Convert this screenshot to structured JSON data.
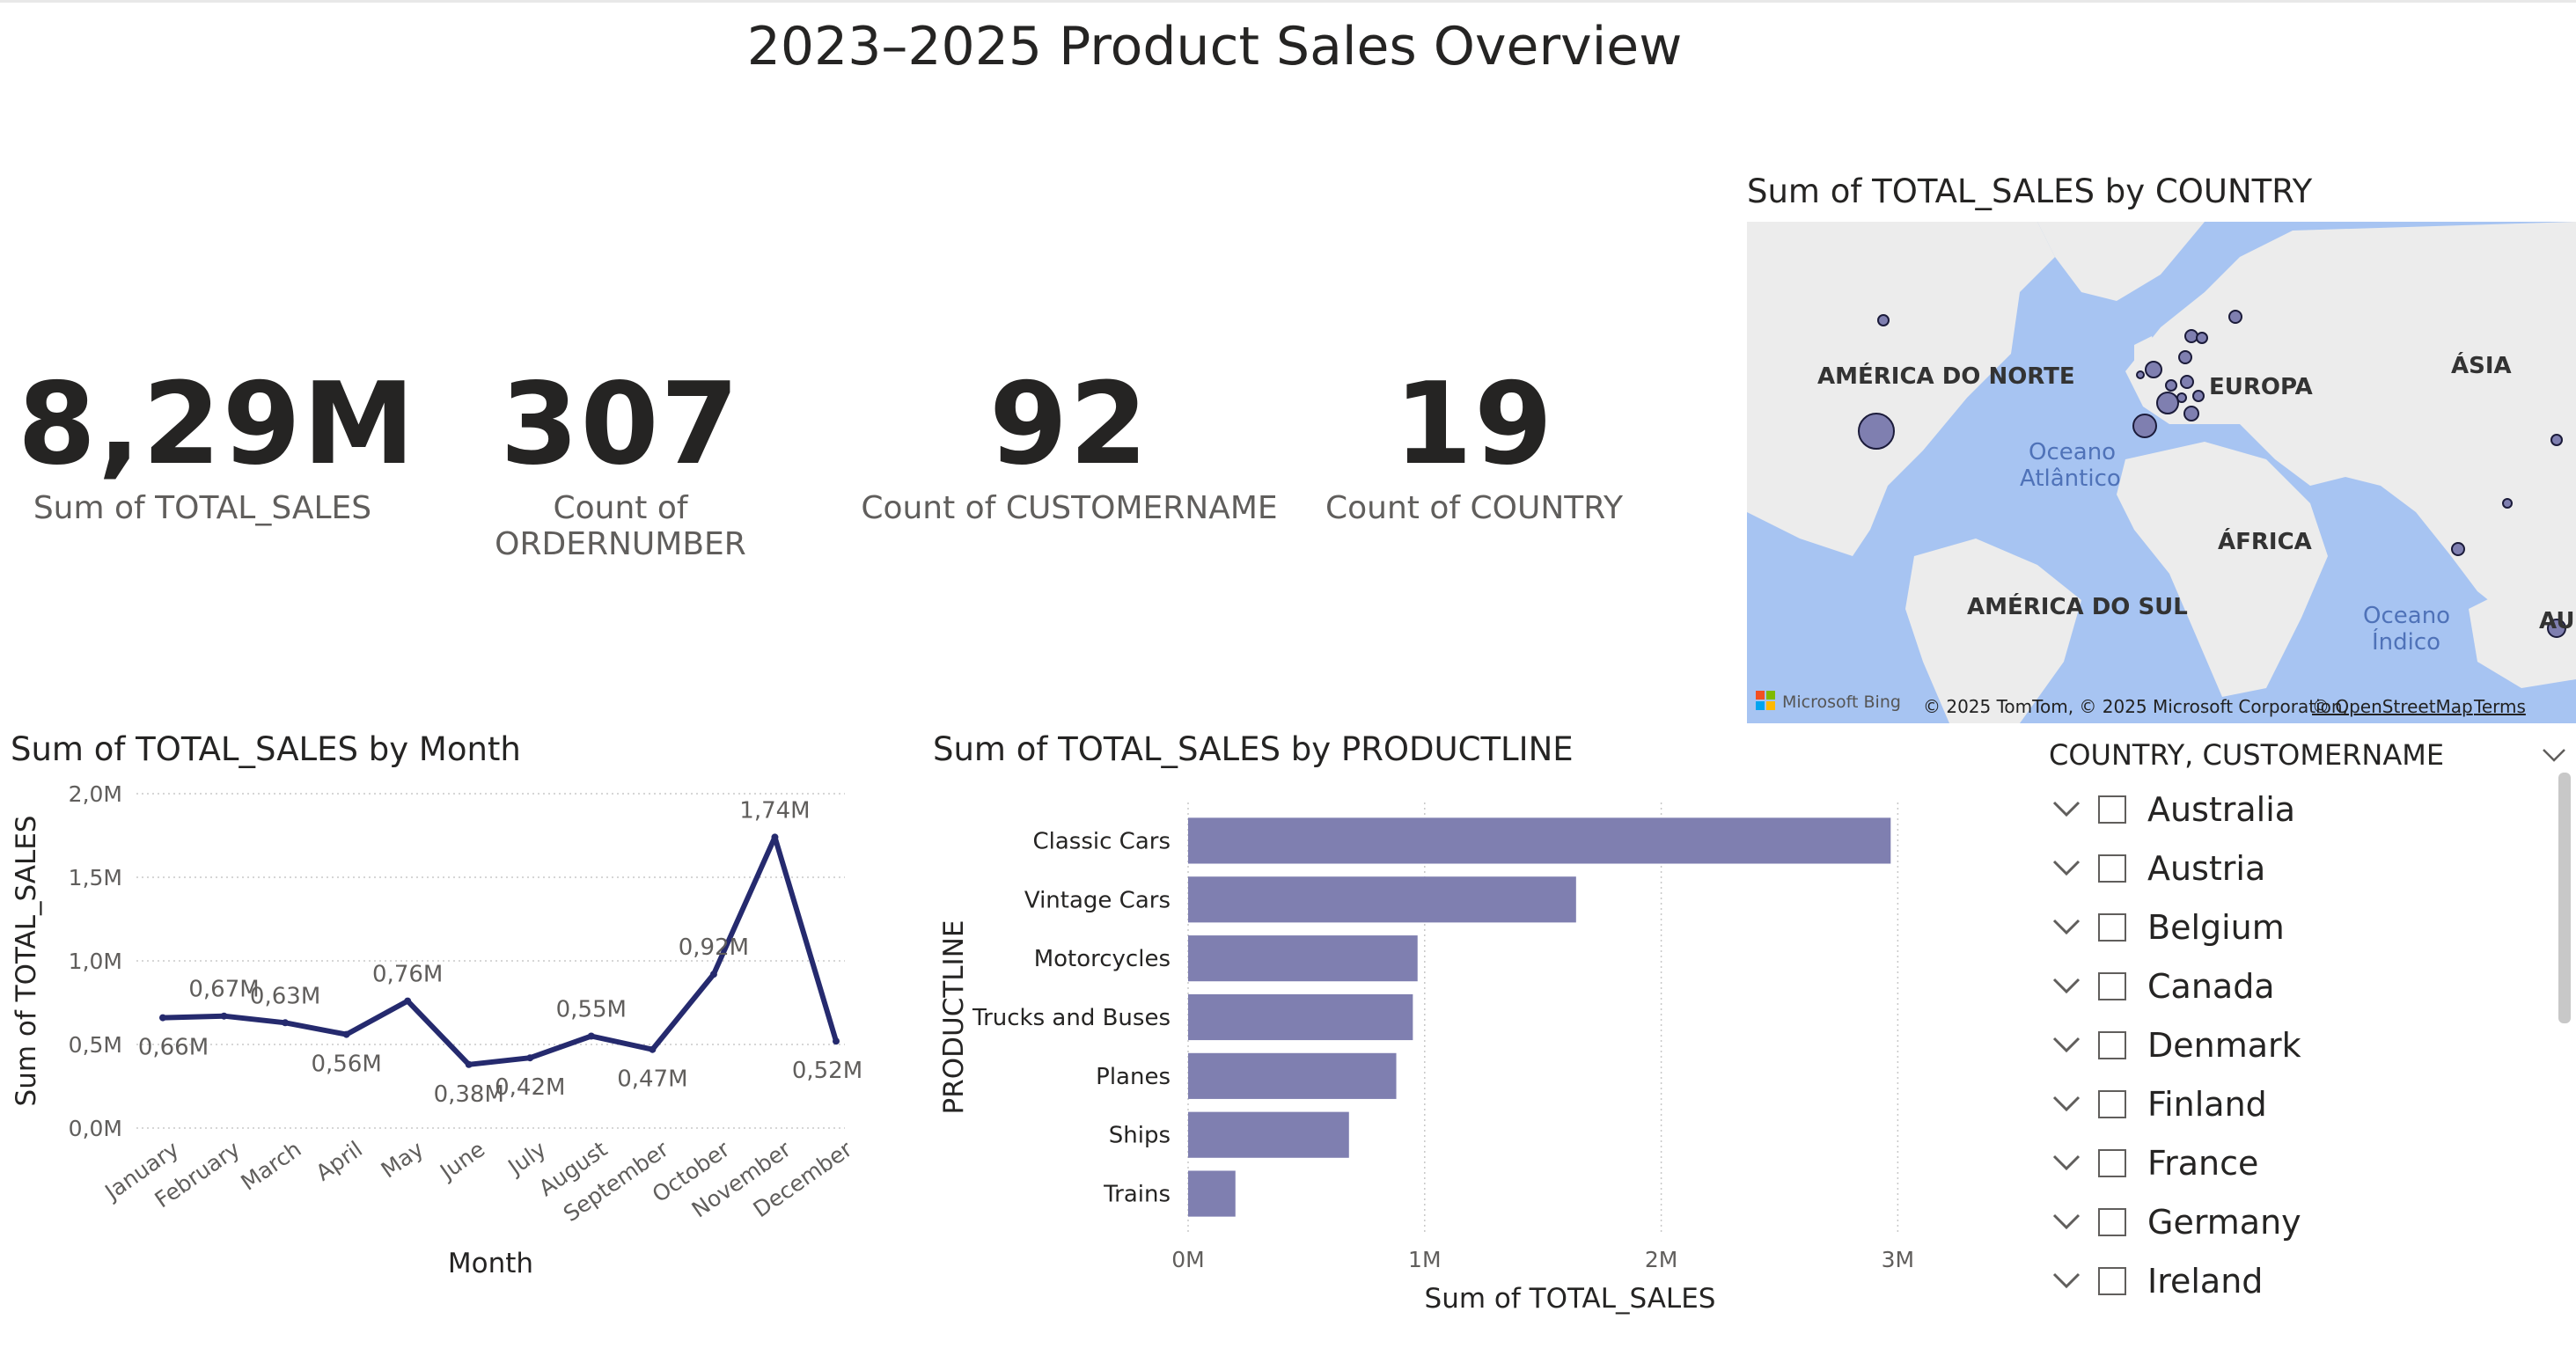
{
  "report": {
    "title": "2023–2025 Product Sales Overview"
  },
  "kpis": [
    {
      "value": "8,29M",
      "label": "Sum of TOTAL_SALES"
    },
    {
      "value": "307",
      "label": "Count of ORDERNUMBER"
    },
    {
      "value": "92",
      "label": "Count of CUSTOMERNAME"
    },
    {
      "value": "19",
      "label": "Count of COUNTRY"
    }
  ],
  "map": {
    "title": "Sum of TOTAL_SALES by COUNTRY",
    "labels": {
      "north_america": "AMÉRICA DO NORTE",
      "europe": "EUROPA",
      "asia": "ÁSIA",
      "africa": "ÁFRICA",
      "south_america": "AMÉRICA DO SUL",
      "australia": "AUS",
      "atlantic_1": "Oceano",
      "atlantic_2": "Atlântico",
      "indian_1": "Oceano",
      "indian_2": "Índico"
    },
    "brand": "Microsoft Bing",
    "copyright": "© 2025 TomTom, © 2025 Microsoft Corporation,",
    "osm_link": "© OpenStreetMap",
    "terms_link": "Terms",
    "bubble_color": "#7f7fb0"
  },
  "line_chart": {
    "title": "Sum of TOTAL_SALES by Month"
  },
  "bar_chart": {
    "title": "Sum of TOTAL_SALES by PRODUCTLINE"
  },
  "chart_data": [
    {
      "type": "line",
      "title": "Sum of TOTAL_SALES by Month",
      "xlabel": "Month",
      "ylabel": "Sum of TOTAL_SALES",
      "x": [
        "January",
        "February",
        "March",
        "April",
        "May",
        "June",
        "July",
        "August",
        "September",
        "October",
        "November",
        "December"
      ],
      "values": [
        0.66,
        0.67,
        0.63,
        0.56,
        0.76,
        0.38,
        0.42,
        0.55,
        0.47,
        0.92,
        1.74,
        0.52
      ],
      "data_labels": [
        "0,66M",
        "0,67M",
        "0,63M",
        "0,56M",
        "0,76M",
        "0,38M",
        "0,42M",
        "0,55M",
        "0,47M",
        "0,92M",
        "1,74M",
        "0,52M"
      ],
      "yticks": [
        0,
        0.5,
        1.0,
        1.5,
        2.0
      ],
      "ytick_labels": [
        "0,0M",
        "0,5M",
        "1,0M",
        "1,5M",
        "2,0M"
      ],
      "ylim": [
        0,
        2.0
      ],
      "grid": true,
      "color": "#252a6e"
    },
    {
      "type": "bar",
      "orientation": "horizontal",
      "title": "Sum of TOTAL_SALES by PRODUCTLINE",
      "xlabel": "Sum of TOTAL_SALES",
      "ylabel": "PRODUCTLINE",
      "categories": [
        "Classic Cars",
        "Vintage Cars",
        "Motorcycles",
        "Trucks and Buses",
        "Planes",
        "Ships",
        "Trains"
      ],
      "values": [
        2.97,
        1.64,
        0.97,
        0.95,
        0.88,
        0.68,
        0.2
      ],
      "xticks": [
        0,
        1,
        2,
        3
      ],
      "xtick_labels": [
        "0M",
        "1M",
        "2M",
        "3M"
      ],
      "xlim": [
        0,
        3
      ],
      "grid": true,
      "color": "#7f7fb0"
    }
  ],
  "slicer": {
    "header": "COUNTRY, CUSTOMERNAME",
    "items": [
      "Australia",
      "Austria",
      "Belgium",
      "Canada",
      "Denmark",
      "Finland",
      "France",
      "Germany",
      "Ireland"
    ]
  }
}
